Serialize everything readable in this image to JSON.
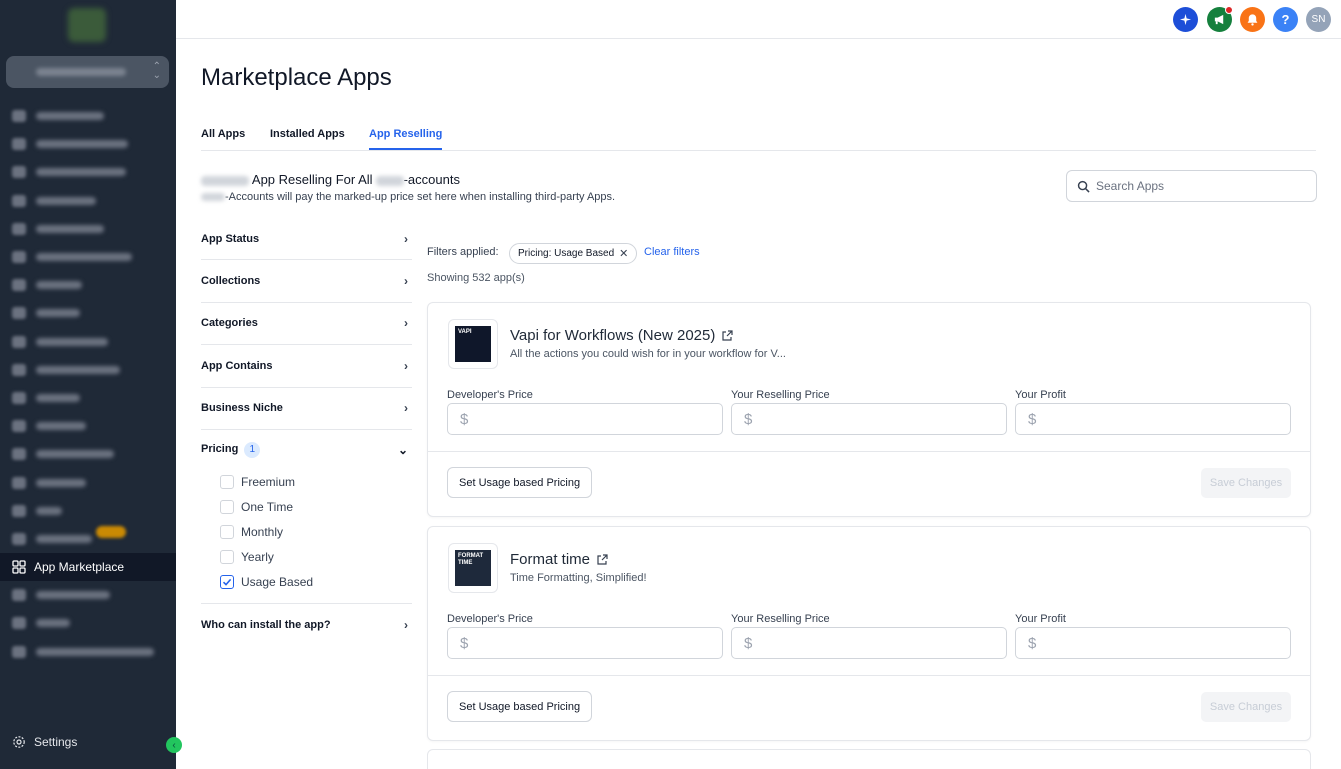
{
  "sidebar": {
    "active_item": "App Marketplace",
    "settings_label": "Settings"
  },
  "topbar": {
    "avatar_initials": "SN",
    "help_label": "?",
    "colors": {
      "ai": "#1d4ed8",
      "announce": "#15803d",
      "bell": "#f97316",
      "help": "#3b82f6",
      "avatar": "#94a3b8"
    }
  },
  "page": {
    "title": "Marketplace Apps",
    "tabs": [
      {
        "label": "All Apps"
      },
      {
        "label": "Installed Apps"
      },
      {
        "label": "App Reselling"
      }
    ],
    "heading": "App Reselling For All",
    "heading_suffix": "-accounts",
    "subheading": "-Accounts will pay the marked-up price set here when installing third-party Apps."
  },
  "search": {
    "placeholder": "Search Apps"
  },
  "filters": {
    "app_status": "App Status",
    "collections": "Collections",
    "categories": "Categories",
    "app_contains": "App Contains",
    "business_niche": "Business Niche",
    "pricing": "Pricing",
    "pricing_count": "1",
    "pricing_options": [
      "Freemium",
      "One Time",
      "Monthly",
      "Yearly",
      "Usage Based"
    ],
    "who_can_install": "Who can install the app?"
  },
  "results": {
    "filters_applied_label": "Filters applied:",
    "chip_label": "Pricing: Usage Based",
    "clear_label": "Clear filters",
    "showing": "Showing 532 app(s)"
  },
  "apps": [
    {
      "name": "Vapi for Workflows (New 2025)",
      "description": "All the actions you could wish for in your workflow for V...",
      "thumb_text": "VAPI"
    },
    {
      "name": "Format time",
      "description": "Time Formatting, Simplified!",
      "thumb_text": "FORMAT TIME"
    }
  ],
  "pricing_fields": {
    "developer": "Developer's Price",
    "reselling": "Your Reselling Price",
    "profit": "Your Profit",
    "currency": "$"
  },
  "buttons": {
    "usage_pricing": "Set Usage based Pricing",
    "save": "Save Changes"
  }
}
